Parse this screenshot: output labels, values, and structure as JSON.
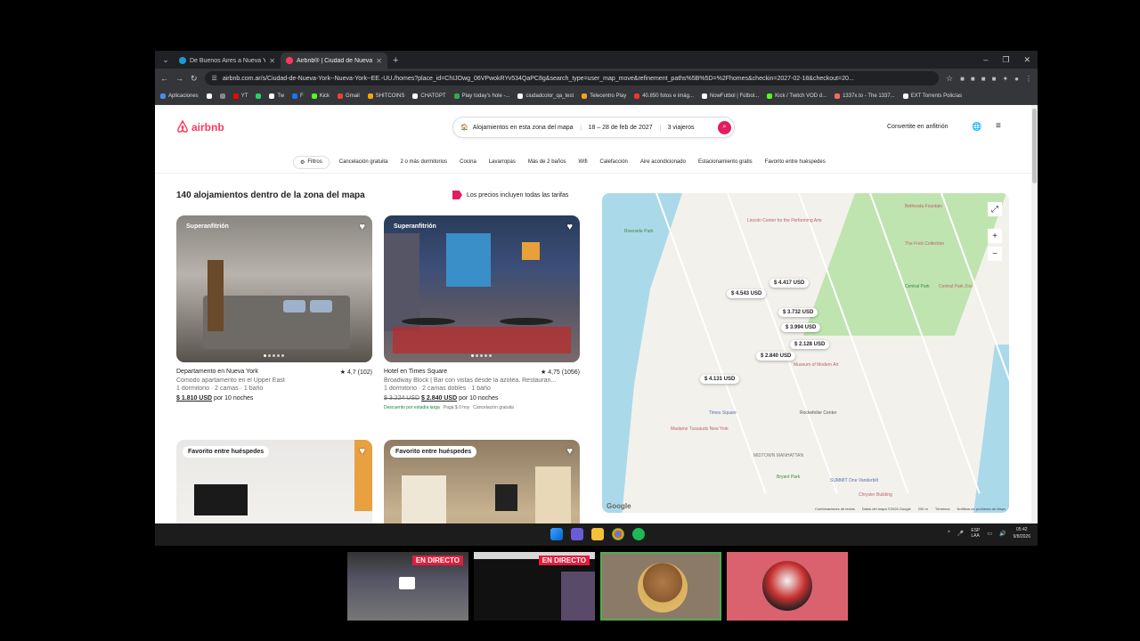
{
  "browser": {
    "tabs": [
      {
        "title": "De Buenos Aires a Nueva York",
        "favicon_color": "#1a9bd7"
      },
      {
        "title": "Airbnb® | Ciudad de Nueva York",
        "favicon_color": "#ff385c"
      }
    ],
    "url": "airbnb.com.ar/s/Ciudad-de-Nueva-York--Nueva-York--EE.-UU./homes?place_id=ChIJOwg_06VPwokRYv534QaPC8g&search_type=user_map_move&refinement_paths%5B%5D=%2Fhomes&checkin=2027-02-18&checkout=20...",
    "bookmarks": [
      "Aplicaciones",
      "YT",
      "",
      "Tw",
      "F",
      "Kick",
      "Gmail",
      "SHITCOINS",
      "CHATGPT",
      "Play today's hole -...",
      "ciudadcolor_qa_test",
      "Telecentro Play",
      "40.850 fotos e imág...",
      "NowFutbol | Fútbol...",
      "Kick / Twitch VOD d...",
      "1337x.to - The 1337...",
      "EXT Torrents Policías"
    ]
  },
  "airbnb": {
    "logo": "airbnb",
    "search": {
      "where": "Alojamientos en esta zona del mapa",
      "dates": "18 – 28 de feb de 2027",
      "guests": "3 viajeros"
    },
    "host_link": "Convertite en anfitrión",
    "filters": [
      "Filtros",
      "Cancelación gratuita",
      "2 o más dormitorios",
      "Cocina",
      "Lavarropas",
      "Más de 2 baños",
      "Wifi",
      "Calefacción",
      "Aire acondicionado",
      "Estacionamiento gratis",
      "Favorito entre huéspedes"
    ],
    "results_title": "140 alojamientos dentro de la zona del mapa",
    "price_note": "Los precios incluyen todas las tarifas",
    "listings": [
      {
        "badge": "Superanfitrión",
        "name": "Departamento en Nueva York",
        "rating": "★ 4,7 (102)",
        "desc": "Cómodo apartamento en el Upper East",
        "details": "1 dormitorio · 2 camas · 1 baño",
        "price": "$ 1.810 USD",
        "price_suffix": "por 10 noches"
      },
      {
        "badge": "Superanfitrión",
        "name": "Hotel en Times Square",
        "rating": "★ 4,75 (1056)",
        "desc": "Broadway Block | Bar con vistas desde la azotea. Restauran...",
        "details": "1 dormitorio · 2 camas dobles · 1 baño",
        "old_price": "$ 3.224 USD",
        "price": "$ 2.840 USD",
        "price_suffix": "por 10 noches",
        "tags": [
          "Descuento por estadía larga",
          "Pagá $ 0 hoy",
          "Cancelación gratuita"
        ]
      },
      {
        "badge": "Favorito entre huéspedes"
      },
      {
        "badge": "Favorito entre huéspedes"
      }
    ],
    "map": {
      "pins": [
        "$ 4.417 USD",
        "$ 4.543 USD",
        "$ 3.732 USD",
        "$ 3.994 USD",
        "$ 2.128 USD",
        "$ 2.840 USD",
        "$ 4.131 USD"
      ],
      "pois": [
        "Lincoln Center for the Performing Arts",
        "Riverside Park",
        "Central Park",
        "The Frick Collection",
        "Central Park Zoo",
        "Museum of Modern Art",
        "Times Square",
        "Madame Tussauds New York",
        "Rockefeller Center",
        "MIDTOWN MANHATTAN",
        "Bryant Park",
        "SUMMIT One Vanderbilt",
        "Chrysler Building",
        "Bethesda Fountain"
      ],
      "zoom_in": "+",
      "zoom_out": "−",
      "google": "Google",
      "footer": [
        "Combinaciones de teclas",
        "Datos del mapa ©2026 Google",
        "200 m",
        "Términos",
        "Notificar un problema de Maps"
      ]
    }
  },
  "taskbar": {
    "lang": "ESP\nLAA",
    "time": "05:42",
    "date": "9/8/2026"
  },
  "stream": {
    "live_label": "EN DIRECTO"
  }
}
